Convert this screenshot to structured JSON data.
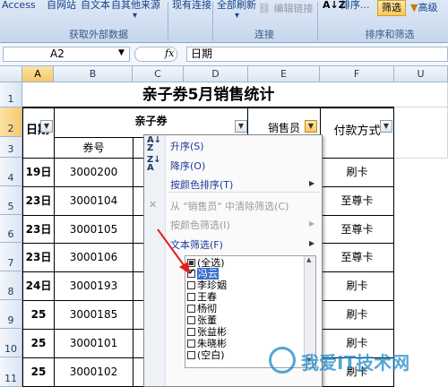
{
  "ribbon": {
    "items": [
      "Access",
      "自网站",
      "自文本",
      "自其他来源",
      "现有连接",
      "全部刷新",
      "编辑链接",
      "排序...",
      "筛选",
      "高级"
    ],
    "groups": [
      "获取外部数据",
      "连接",
      "排序和筛选"
    ]
  },
  "formula_bar": {
    "name_box": "A2",
    "fx": "fx",
    "content": "日期"
  },
  "columns": [
    "A",
    "B",
    "C",
    "D",
    "E",
    "F",
    "U"
  ],
  "rows": [
    "1",
    "2",
    "3",
    "4",
    "5",
    "6",
    "7",
    "8",
    "9",
    "10",
    "11"
  ],
  "sheet": {
    "title": "亲子券5月销售统计",
    "h_date": "日期",
    "h_coupon": "亲子券",
    "h_no": "券号",
    "h_seller": "销售员",
    "h_payment": "付款方式",
    "data": [
      {
        "date": "19日",
        "no": "3000200",
        "pay": "刷卡"
      },
      {
        "date": "23日",
        "no": "3000104",
        "pay": "至尊卡"
      },
      {
        "date": "23日",
        "no": "3000105",
        "pay": "至尊卡"
      },
      {
        "date": "23日",
        "no": "3000106",
        "pay": "至尊卡"
      },
      {
        "date": "24日",
        "no": "3000193",
        "pay": "刷卡"
      },
      {
        "date": "25",
        "no": "3000185",
        "pay": "刷卡"
      },
      {
        "date": "25",
        "no": "3000101",
        "pay": "刷卡"
      },
      {
        "date": "25",
        "no": "3000102",
        "pay": "刷卡"
      }
    ]
  },
  "menu": {
    "sort_asc": "升序(S)",
    "sort_desc": "降序(O)",
    "sort_color": "按颜色排序(T)",
    "clear": "从 \"销售员\" 中清除筛选(C)",
    "filter_color": "按颜色筛选(I)",
    "text_filter": "文本筛选(F)",
    "list": [
      "(全选)",
      "冯云",
      "李珍姻",
      "王春",
      "杨彻",
      "张董",
      "张益彬",
      "朱晓彬",
      "(空白)"
    ]
  },
  "watermark": "我爱IT技术网"
}
